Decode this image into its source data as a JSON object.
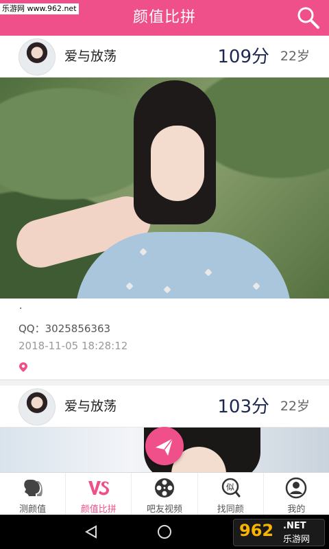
{
  "watermark_top": "乐游网 www.962.net",
  "header": {
    "title": "颜值比拼",
    "accent": "#f0508a"
  },
  "posts": [
    {
      "username": "爱与放荡",
      "score": "109分",
      "age": "22岁",
      "caption": "·",
      "qq": "QQ：3025856363",
      "timestamp": "2018-11-05 18:28:12"
    },
    {
      "username": "爱与放荡",
      "score": "103分",
      "age": "22岁"
    }
  ],
  "tabs": [
    {
      "label": "测颜值",
      "icon": "face-profile-icon",
      "active": false
    },
    {
      "label": "颜值比拼",
      "icon": "vs-icon",
      "active": true
    },
    {
      "label": "吧友视频",
      "icon": "film-reel-icon",
      "active": false
    },
    {
      "label": "找同颜",
      "icon": "similar-face-icon",
      "active": false
    },
    {
      "label": "我的",
      "icon": "user-icon",
      "active": false
    }
  ],
  "logo": {
    "number": "962",
    "net": ".NET",
    "sub": "乐游网"
  }
}
